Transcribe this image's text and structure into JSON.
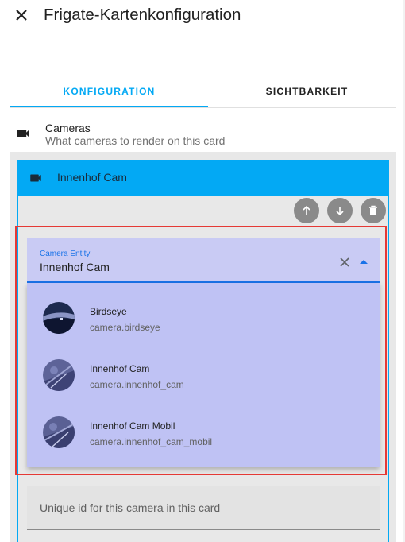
{
  "dialog": {
    "title": "Frigate-Kartenkonfiguration",
    "close_icon": "close-icon"
  },
  "tabs": [
    {
      "label": "KONFIGURATION",
      "active": true
    },
    {
      "label": "SICHTBARKEIT",
      "active": false
    }
  ],
  "section": {
    "title": "Cameras",
    "description": "What cameras to render on this card",
    "icon": "video-camera-icon"
  },
  "camera_row": {
    "label": "Innenhof Cam",
    "icon": "video-camera-icon"
  },
  "camera_actions": [
    "arrow-up-icon",
    "arrow-down-icon",
    "delete-icon"
  ],
  "camera_entity_field": {
    "label": "Camera Entity",
    "value": "Innenhof Cam"
  },
  "dropdown_options": [
    {
      "name": "Birdseye",
      "entity": "camera.birdseye"
    },
    {
      "name": "Innenhof Cam",
      "entity": "camera.innenhof_cam"
    },
    {
      "name": "Innenhof Cam Mobil",
      "entity": "camera.innenhof_cam_mobil"
    }
  ],
  "unique_id_field": {
    "placeholder": "Unique id for this camera in this card"
  },
  "colors": {
    "accent": "#03a9f4",
    "highlight": "#e53935",
    "dropdown_bg": "#bfc2f4",
    "field_focus": "#1a73e8"
  }
}
